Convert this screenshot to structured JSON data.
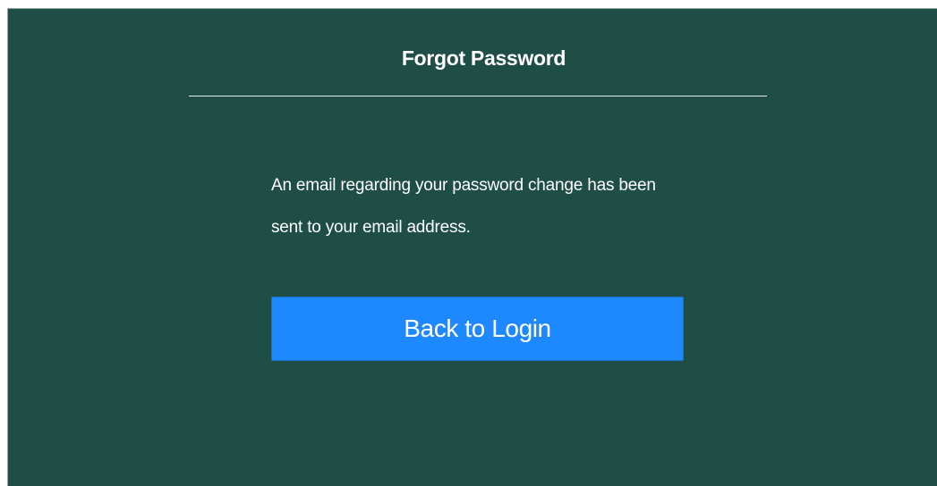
{
  "dialog": {
    "title": "Forgot Password",
    "message_line1": "An email regarding your password change has been",
    "message_line2": "sent to your email address.",
    "back_button_label": "Back to Login"
  },
  "colors": {
    "panel_background": "#1e4e46",
    "button_background": "#1e88ff",
    "text": "#ffffff"
  }
}
